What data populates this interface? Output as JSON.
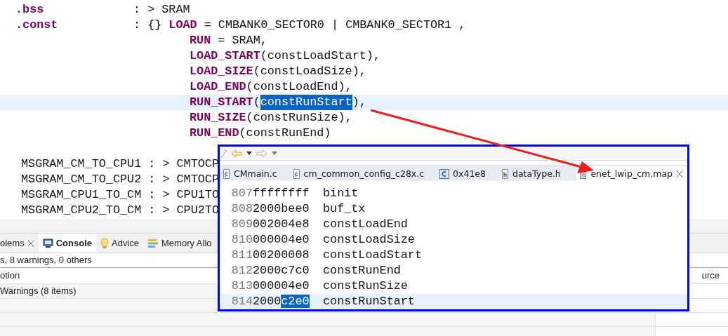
{
  "editor": {
    "lines": [
      {
        "kind": "section",
        "name": ".bss",
        "current": false,
        "segments": [
          {
            "text": ": > SRAM",
            "kind": "plain"
          }
        ]
      },
      {
        "kind": "section",
        "name": ".const",
        "current": false,
        "segments": [
          {
            "text": ": {} ",
            "kind": "plain"
          },
          {
            "text": "LOAD",
            "kind": "keyword"
          },
          {
            "text": " = CMBANK0_SECTOR0 | CMBANK0_SECTOR1 ,",
            "kind": "plain"
          }
        ]
      },
      {
        "kind": "continuation",
        "current": false,
        "segments": [
          {
            "text": "RUN",
            "kind": "keyword"
          },
          {
            "text": " = SRAM,",
            "kind": "plain"
          }
        ]
      },
      {
        "kind": "continuation",
        "current": false,
        "segments": [
          {
            "text": "LOAD_START",
            "kind": "keyword"
          },
          {
            "text": "(constLoadStart),",
            "kind": "plain"
          }
        ]
      },
      {
        "kind": "continuation",
        "current": false,
        "segments": [
          {
            "text": "LOAD_SIZE",
            "kind": "keyword"
          },
          {
            "text": "(constLoadSize),",
            "kind": "plain"
          }
        ]
      },
      {
        "kind": "continuation",
        "current": false,
        "segments": [
          {
            "text": "LOAD_END",
            "kind": "keyword"
          },
          {
            "text": "(constLoadEnd),",
            "kind": "plain"
          }
        ]
      },
      {
        "kind": "continuation",
        "current": true,
        "segments": [
          {
            "text": "RUN_START",
            "kind": "keyword"
          },
          {
            "text": "(",
            "kind": "plain"
          },
          {
            "text": "constRunStart",
            "kind": "selected"
          },
          {
            "text": "),",
            "kind": "plain"
          }
        ]
      },
      {
        "kind": "continuation",
        "current": false,
        "segments": [
          {
            "text": "RUN_SIZE",
            "kind": "keyword"
          },
          {
            "text": "(constRunSize),",
            "kind": "plain"
          }
        ]
      },
      {
        "kind": "continuation",
        "current": false,
        "segments": [
          {
            "text": "RUN_END",
            "kind": "keyword"
          },
          {
            "text": "(constRunEnd)",
            "kind": "plain"
          }
        ]
      },
      {
        "kind": "plain",
        "current": false,
        "segments": [
          {
            "text": "MSGRAM_CM_TO_CPU1 : > CMTOCP",
            "kind": "plain"
          }
        ]
      },
      {
        "kind": "plain",
        "current": false,
        "segments": [
          {
            "text": "MSGRAM_CM_TO_CPU2 : > CMTOCP",
            "kind": "plain"
          }
        ]
      },
      {
        "kind": "plain",
        "current": false,
        "segments": [
          {
            "text": "MSGRAM_CPU1_TO_CM : > CPU1TO",
            "kind": "plain"
          }
        ]
      },
      {
        "kind": "plain",
        "current": false,
        "segments": [
          {
            "text": "MSGRAM_CPU2_TO_CM : > CPU2TO",
            "kind": "plain"
          }
        ]
      }
    ]
  },
  "bottom_panel": {
    "tabs": [
      {
        "label": "olems",
        "kind": "plain",
        "selected": false,
        "closable": true
      },
      {
        "label": "Console",
        "kind": "console",
        "selected": true,
        "closable": false
      },
      {
        "label": "Advice",
        "kind": "advice",
        "selected": false,
        "closable": false
      },
      {
        "label": "Memory Allo",
        "kind": "memory",
        "selected": false,
        "closable": false
      }
    ],
    "summary": "s, 8 warnings, 0 others",
    "columns": [
      "otion",
      "urce"
    ],
    "rows": [
      {
        "text": "Warnings (8 items)"
      }
    ]
  },
  "map_view": {
    "tabs": [
      {
        "label": "CMmain.c",
        "kind": "source",
        "selected": false,
        "closable": false
      },
      {
        "label": "cm_common_config_c28x.c",
        "kind": "source",
        "selected": false,
        "closable": false
      },
      {
        "label": "0x41e8",
        "kind": "disassembly",
        "selected": false,
        "closable": false
      },
      {
        "label": "dataType.h",
        "kind": "header",
        "selected": false,
        "closable": false
      },
      {
        "label": "enet_lwip_cm.map",
        "kind": "text",
        "selected": true,
        "closable": true
      }
    ],
    "lines": [
      {
        "number": "807",
        "address": [
          {
            "text": "ffffffff",
            "selected": false
          }
        ],
        "symbol": "binit",
        "current": false
      },
      {
        "number": "808",
        "address": [
          {
            "text": "2000bee0",
            "selected": false
          }
        ],
        "symbol": "buf_tx",
        "current": false
      },
      {
        "number": "809",
        "address": [
          {
            "text": "002004e8",
            "selected": false
          }
        ],
        "symbol": "constLoadEnd",
        "current": false
      },
      {
        "number": "810",
        "address": [
          {
            "text": "000004e0",
            "selected": false
          }
        ],
        "symbol": "constLoadSize",
        "current": false
      },
      {
        "number": "811",
        "address": [
          {
            "text": "00200008",
            "selected": false
          }
        ],
        "symbol": "constLoadStart",
        "current": false
      },
      {
        "number": "812",
        "address": [
          {
            "text": "2000c7c0",
            "selected": false
          }
        ],
        "symbol": "constRunEnd",
        "current": false
      },
      {
        "number": "813",
        "address": [
          {
            "text": "000004e0",
            "selected": false
          }
        ],
        "symbol": "constRunSize",
        "current": false
      },
      {
        "number": "814",
        "address": [
          {
            "text": "2000",
            "selected": false
          },
          {
            "text": "c2e0",
            "selected": true
          }
        ],
        "symbol": "constRunStart",
        "current": true
      }
    ]
  }
}
